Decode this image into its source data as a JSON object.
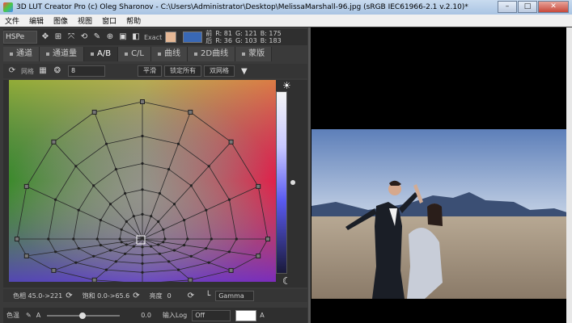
{
  "window": {
    "title": "3D LUT Creator Pro (c) Oleg Sharonov - C:\\Users\\Administrator\\Desktop\\MelissaMarshall-96.jpg (sRGB IEC61966-2.1 v.2.10)*",
    "minimize": "–",
    "maximize": "□",
    "close": "✕"
  },
  "menu": [
    "文件",
    "编辑",
    "图像",
    "视图",
    "窗口",
    "帮助"
  ],
  "toolbar": {
    "mode": "HSPe",
    "exact_label": "Exact",
    "before_label": "前",
    "after_label": "后",
    "rgb_row1": {
      "r": "R: 81",
      "g": "G: 121",
      "b": "B: 175"
    },
    "rgb_row2": {
      "r": "R: 36",
      "g": "G: 103",
      "b": "B: 183"
    }
  },
  "tabs": [
    {
      "label": "通道"
    },
    {
      "label": "通道量"
    },
    {
      "label": "A/B"
    },
    {
      "label": "C/L"
    },
    {
      "label": "曲线"
    },
    {
      "label": "2D曲线"
    },
    {
      "label": "蒙版"
    }
  ],
  "controls": {
    "grid_label": "网格",
    "grid_value": "8",
    "smooth_button": "平滑",
    "lock_all_button": "锁定所有",
    "double_grid_button": "双网格"
  },
  "status": {
    "hue": "色相 45.0->221",
    "saturation": "饱和 0.0->65.6",
    "brightness_label": "亮度",
    "brightness_value": "0",
    "gamma_label": "Gamma"
  },
  "bottom": {
    "label": "色温",
    "a_label": "A",
    "slider_value": "0.0",
    "input_log_label": "输入Log",
    "input_log_value": "Off",
    "right_a": "A"
  },
  "colors": {
    "swatch_skin": "#e5b896",
    "swatch_blue": "#3968b5"
  }
}
